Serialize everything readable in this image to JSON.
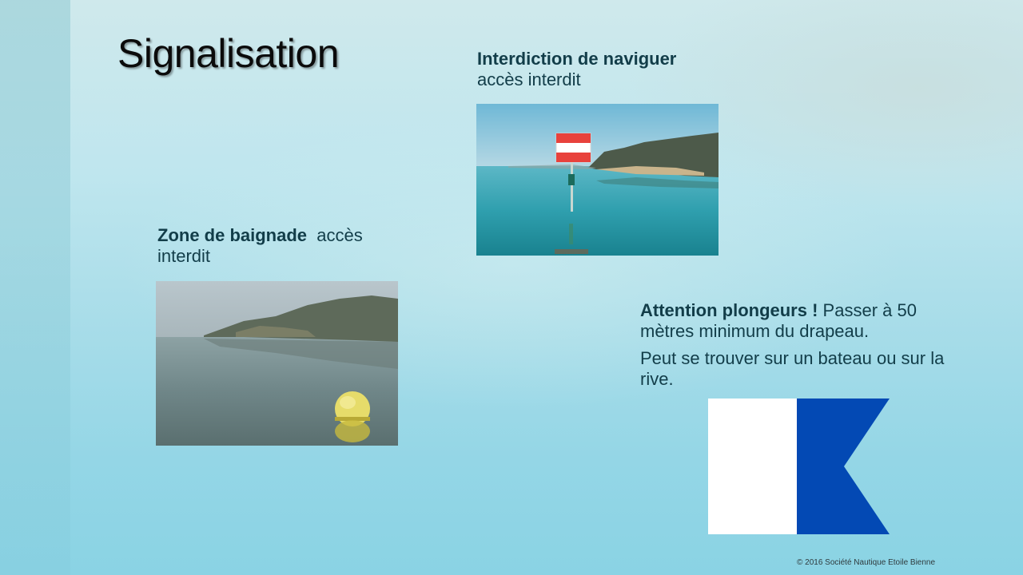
{
  "slide": {
    "title": "Signalisation",
    "copyright": "© 2016 Société Nautique Etoile Bienne"
  },
  "interdiction": {
    "title": "Interdiction de naviguer",
    "text": "accès interdit"
  },
  "baignade": {
    "title": "Zone de baignade",
    "text": "accès interdit"
  },
  "plongeurs": {
    "title": "Attention plongeurs !",
    "text": "Passer à 50 mètres minimum du drapeau.",
    "note": "Peut se trouver sur un bateau ou sur la rive."
  },
  "colors": {
    "caption_text": "#123d49",
    "flag_blue": "#0349b4",
    "flag_white": "#ffffff",
    "sign_red": "#e8423c"
  },
  "images": {
    "photo_interdiction": "lake-photo-red-white-sign",
    "photo_baignade": "lake-photo-yellow-buoy",
    "flag": "alpha-diving-flag"
  }
}
